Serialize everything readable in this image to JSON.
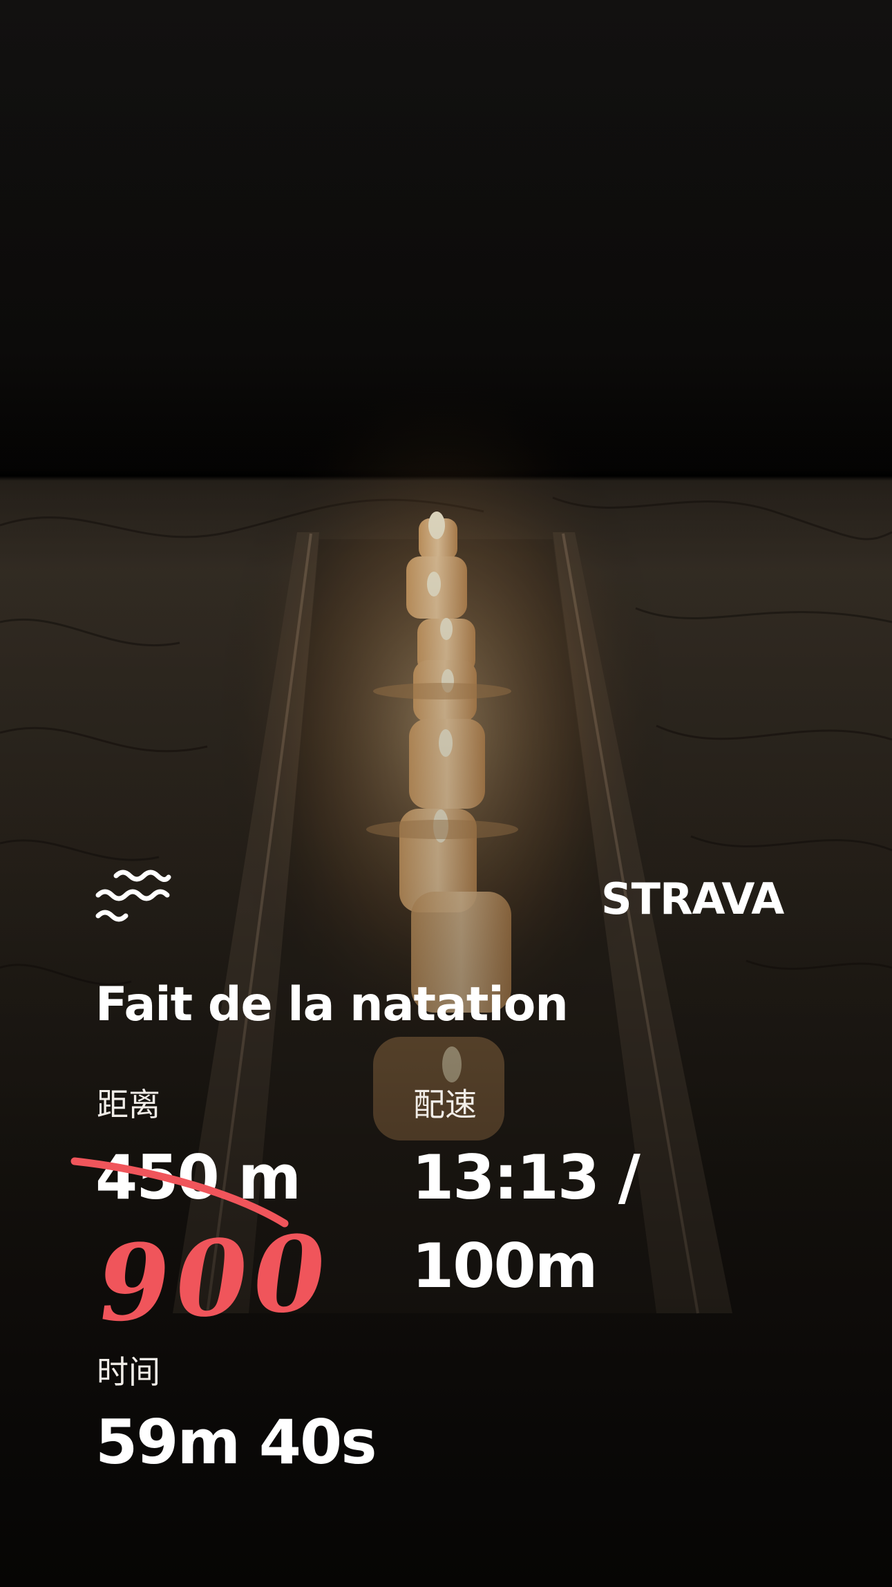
{
  "brand": {
    "name": "STRAVA"
  },
  "activity": {
    "title": "Fait de la natation",
    "icon": "swim-waves-icon"
  },
  "stats": {
    "distance": {
      "label": "距离",
      "value": "450 m"
    },
    "pace": {
      "label": "配速",
      "value": "13:13 / 100m"
    },
    "time": {
      "label": "时间",
      "value": "59m 40s"
    }
  },
  "annotation": {
    "handwritten_value": "900",
    "color": "#f0555b"
  },
  "colors": {
    "text": "#ffffff",
    "background_dark": "#0b0908",
    "marble": "#3b3329",
    "candle_glow": "#f7c98a"
  }
}
